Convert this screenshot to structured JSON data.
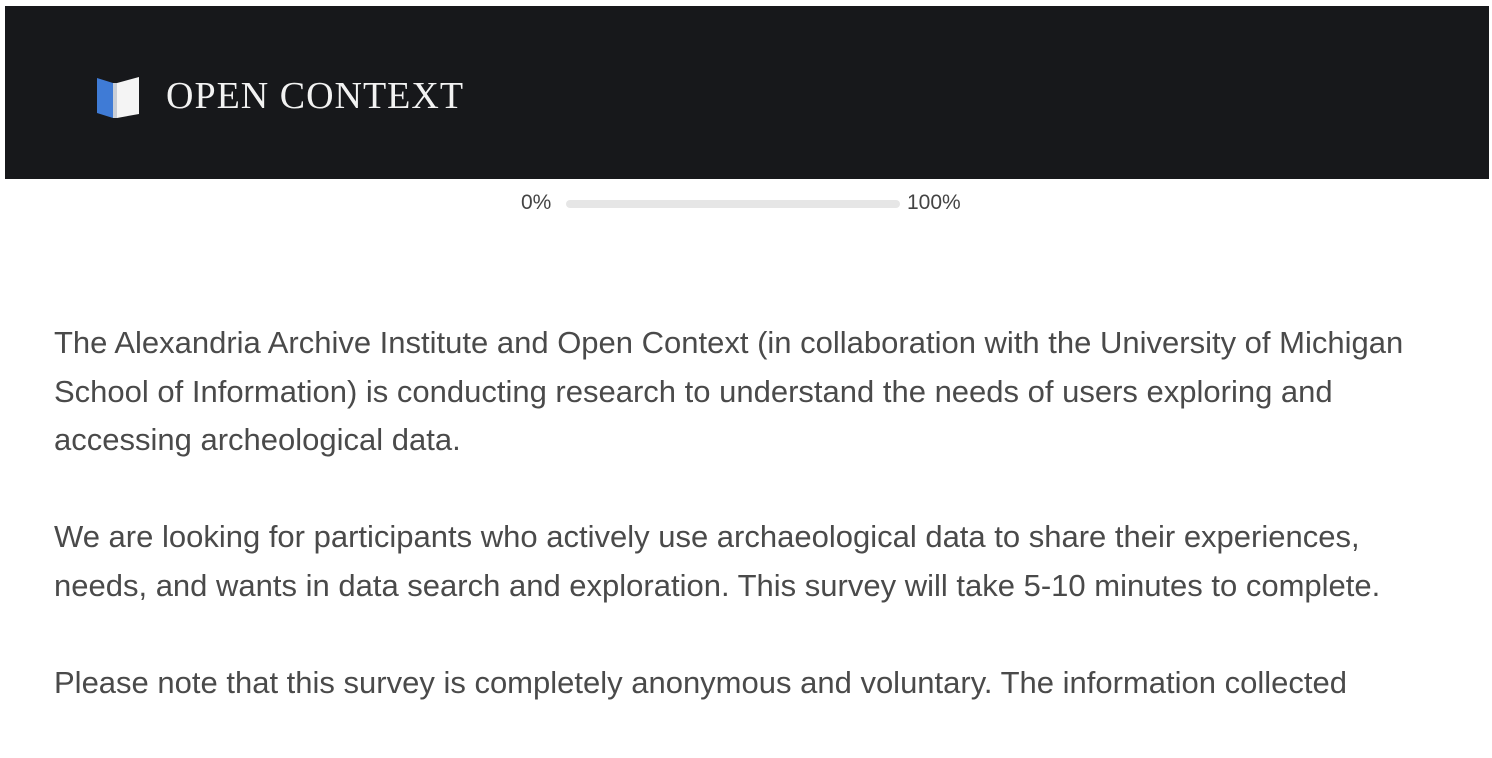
{
  "header": {
    "logo_text": "OPEN CONTEXT",
    "logo_icon": "open-book-flag-icon",
    "background_color": "#17181b",
    "logo_accent_color": "#3f7bd6"
  },
  "progress": {
    "start_label": "0%",
    "end_label": "100%",
    "value": 0
  },
  "content": {
    "paragraphs": [
      "The Alexandria Archive Institute and Open Context (in collaboration with the University of Michigan School of Information) is conducting research to understand the needs of users exploring and accessing archeological data.",
      "We are looking for participants who actively use archaeological data to share their experiences, needs, and wants in data search and exploration. This survey will take 5-10 minutes to complete.",
      "Please note that this survey is completely anonymous and voluntary. The information collected"
    ]
  }
}
